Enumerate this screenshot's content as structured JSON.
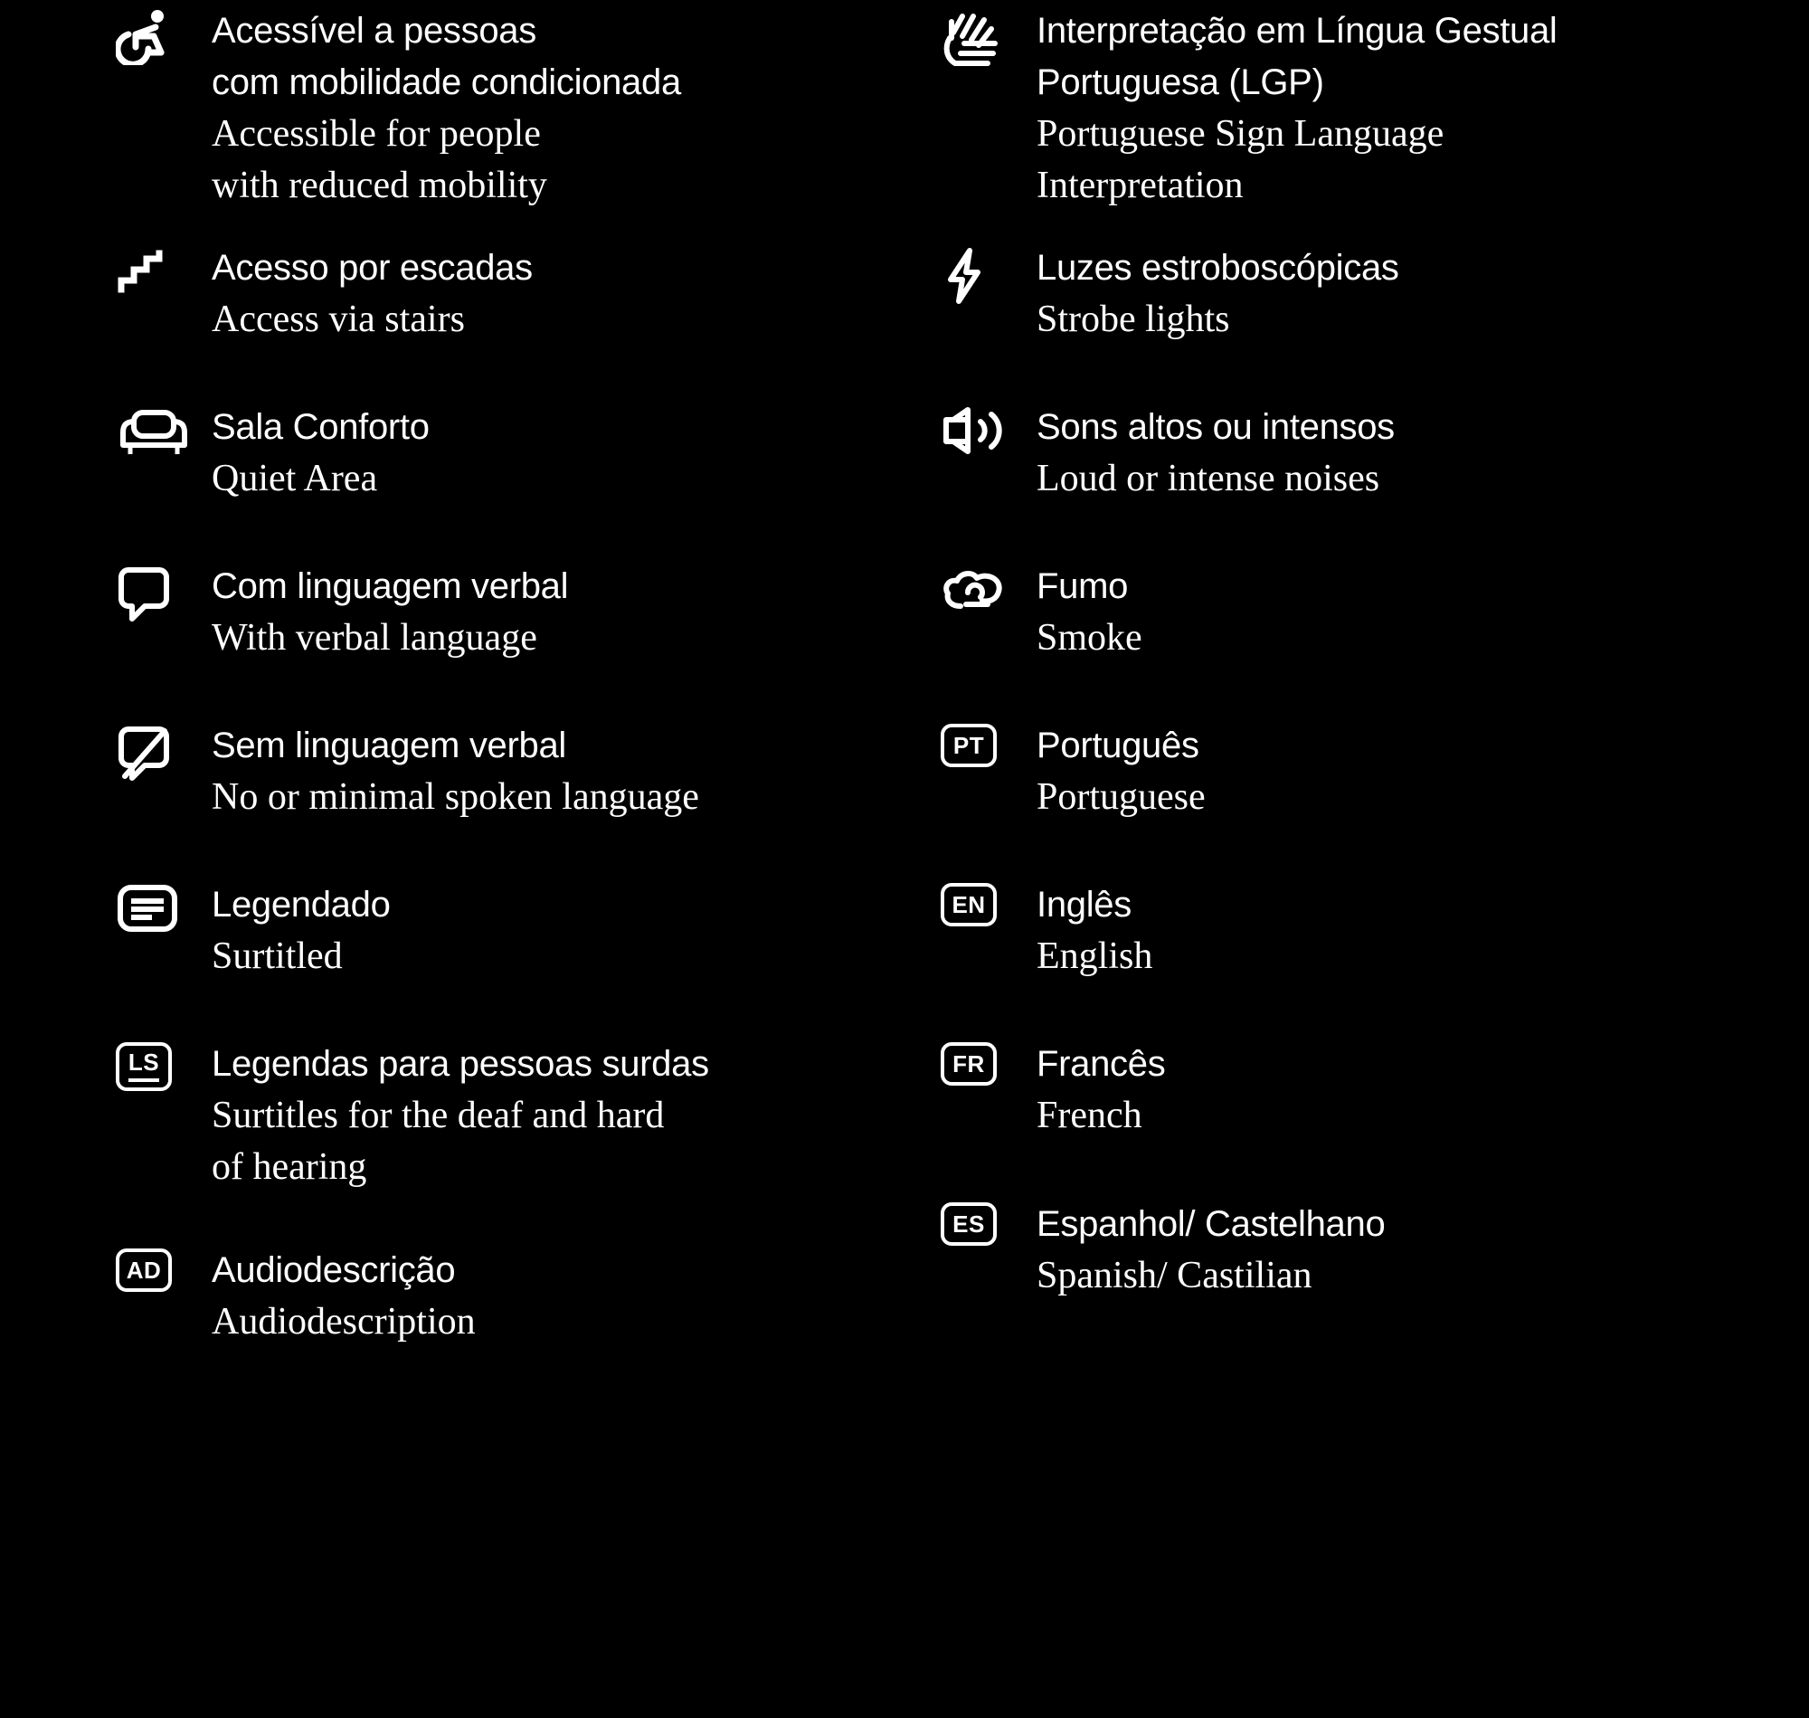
{
  "theme": {
    "background": "#000000",
    "foreground": "#ffffff"
  },
  "legend": {
    "left_column": [
      {
        "icon": "wheelchair-accessible-icon",
        "pt": "Acessível a pessoas\ncom mobilidade condicionada",
        "en": "Accessible for people\nwith reduced mobility"
      },
      {
        "icon": "stairs-icon",
        "pt": "Acesso por escadas",
        "en": "Access via stairs"
      },
      {
        "icon": "sofa-icon",
        "pt": "Sala Conforto",
        "en": "Quiet Area"
      },
      {
        "icon": "speech-bubble-icon",
        "pt": "Com linguagem verbal",
        "en": "With verbal language"
      },
      {
        "icon": "speech-bubble-crossed-icon",
        "pt": "Sem linguagem verbal",
        "en": "No or minimal spoken language"
      },
      {
        "icon": "surtitles-icon",
        "pt": "Legendado",
        "en": "Surtitled"
      },
      {
        "icon": "ls-badge-icon",
        "badge_text": "LS",
        "pt": "Legendas para pessoas surdas",
        "en": "Surtitles for the deaf and hard\nof hearing"
      },
      {
        "icon": "ad-badge-icon",
        "badge_text": "AD",
        "pt": "Audiodescrição",
        "en": "Audiodescription"
      }
    ],
    "right_column": [
      {
        "icon": "sign-language-hand-icon",
        "pt": "Interpretação em Língua Gestual\nPortuguesa (LGP)",
        "en": "Portuguese Sign Language\nInterpretation"
      },
      {
        "icon": "lightning-bolt-icon",
        "pt": "Luzes estroboscópicas",
        "en": "Strobe lights"
      },
      {
        "icon": "loud-speaker-icon",
        "pt": "Sons altos ou intensos",
        "en": "Loud or intense noises"
      },
      {
        "icon": "smoke-cloud-icon",
        "pt": "Fumo",
        "en": "Smoke"
      },
      {
        "icon": "pt-badge-icon",
        "badge_text": "PT",
        "pt": "Português",
        "en": "Portuguese"
      },
      {
        "icon": "en-badge-icon",
        "badge_text": "EN",
        "pt": "Inglês",
        "en": "English"
      },
      {
        "icon": "fr-badge-icon",
        "badge_text": "FR",
        "pt": "Francês",
        "en": "French"
      },
      {
        "icon": "es-badge-icon",
        "badge_text": "ES",
        "pt": "Espanhol/ Castelhano",
        "en": "Spanish/ Castilian"
      }
    ]
  }
}
